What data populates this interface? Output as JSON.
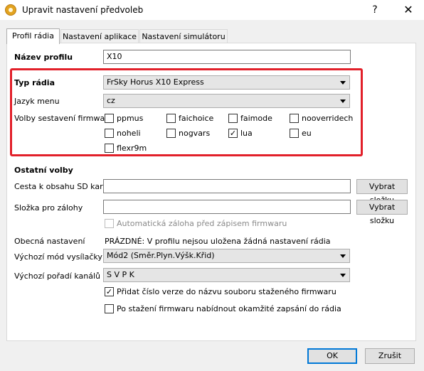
{
  "window": {
    "title": "Upravit nastavení předvoleb",
    "help": "?",
    "close": "✕"
  },
  "tabs": [
    "Profil rádia",
    "Nastavení aplikace",
    "Nastavení simulátoru"
  ],
  "profile": {
    "name_label": "Název profilu",
    "name_value": "X10"
  },
  "radio": {
    "type_label": "Typ rádia",
    "type_value": "FrSky Horus X10 Express",
    "menu_lang_label": "Jazyk menu",
    "menu_lang_value": "cz",
    "firmware_label": "Volby sestavení firmware",
    "options": [
      {
        "label": "ppmus",
        "checked": false
      },
      {
        "label": "faichoice",
        "checked": false
      },
      {
        "label": "faimode",
        "checked": false
      },
      {
        "label": "nooverridech",
        "checked": false
      },
      {
        "label": "noheli",
        "checked": false
      },
      {
        "label": "nogvars",
        "checked": false
      },
      {
        "label": "lua",
        "checked": true
      },
      {
        "label": "eu",
        "checked": false
      },
      {
        "label": "flexr9m",
        "checked": false
      }
    ]
  },
  "other": {
    "heading": "Ostatní volby",
    "sd_label": "Cesta k obsahu SD karty",
    "sd_value": "",
    "sd_button": "Vybrat složku",
    "backup_label": "Složka pro zálohy",
    "backup_value": "",
    "backup_button": "Vybrat složku",
    "auto_backup": "Automatická záloha před zápisem firmwaru",
    "general_label": "Obecná nastavení",
    "general_value": "PRÁZDNÉ: V profilu nejsou uložena žádná nastavení rádia",
    "mode_label": "Výchozí mód vysílačky",
    "mode_value": "Mód2 (Směr.Plyn.Výšk.Křid)",
    "order_label": "Výchozí pořadí kanálů",
    "order_value": "S V P K",
    "append_version": "Přidat číslo verze do názvu souboru staženého firmwaru",
    "append_version_checked": true,
    "offer_flash": "Po stažení firmwaru nabídnout okamžité zapsání do rádia",
    "offer_flash_checked": false
  },
  "footer": {
    "ok": "OK",
    "cancel": "Zrušit"
  },
  "colors": {
    "highlight": "#e2202a",
    "accent": "#0078d7"
  }
}
